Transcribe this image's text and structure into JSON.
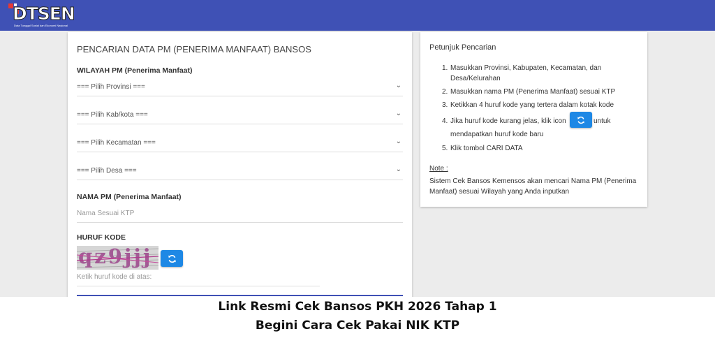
{
  "header": {
    "logo_text": "DTSEN",
    "logo_tagline": "Data Tunggal Sosial dan Ekonomi Nasional",
    "bar_color": "#3f51b5"
  },
  "search_form": {
    "title": "PENCARIAN DATA PM (PENERIMA MANFAAT) BANSOS",
    "region_label": "WILAYAH PM (Penerima Manfaat)",
    "province_select": "=== Pilih Provinsi ===",
    "regency_select": "=== Pilih Kab/kota ===",
    "district_select": "=== Pilih Kecamatan ===",
    "village_select": "=== Pilih Desa ===",
    "name_label": "NAMA PM (Penerima Manfaat)",
    "name_placeholder": "Nama Sesuai KTP",
    "code_label": "HURUF KODE",
    "captcha_text": "qz9jjj",
    "refresh_icon": "refresh-icon",
    "code_placeholder": "Ketik huruf kode di atas:"
  },
  "instructions": {
    "title": "Petunjuk Pencarian",
    "steps": [
      {
        "num": "1.",
        "text": "Masukkan Provinsi, Kabupaten, Kecamatan, dan Desa/Kelurahan"
      },
      {
        "num": "2.",
        "text": "Masukkan nama PM (Penerima Manfaat) sesuai KTP"
      },
      {
        "num": "3.",
        "text": "Ketikkan 4 huruf kode yang tertera dalam kotak kode"
      },
      {
        "num": "4.",
        "text_before": "Jika huruf kode kurang jelas, klik icon",
        "text_after": "untuk",
        "text_cont": "mendapatkan huruf kode baru"
      },
      {
        "num": "5.",
        "text": "Klik tombol CARI DATA"
      }
    ],
    "note_label": "Note :",
    "note_text": "Sistem Cek Bansos Kemensos akan mencari Nama PM (Penerima Manfaat) sesuai Wilayah yang Anda inputkan"
  },
  "banner": {
    "line1": "Link Resmi Cek Bansos PKH 2026 Tahap 1",
    "line2": "Begini Cara Cek Pakai NIK KTP"
  }
}
